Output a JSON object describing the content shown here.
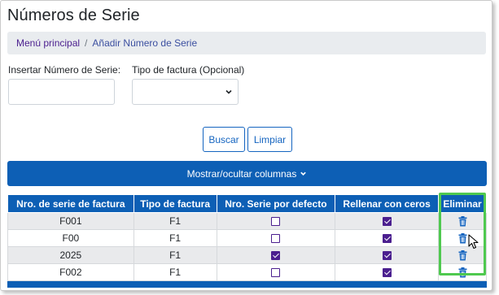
{
  "page": {
    "title": "Números de Serie"
  },
  "breadcrumb": {
    "home": "Menú principal",
    "separator": "/",
    "current": "Añadir Número de Serie"
  },
  "form": {
    "serie_label": "Insertar Número de Serie:",
    "serie_value": "",
    "tipo_label": "Tipo de factura (Opcional)",
    "tipo_selected": ""
  },
  "buttons": {
    "buscar": "Buscar",
    "limpiar": "Limpiar"
  },
  "toggle_columns": {
    "label": "Mostrar/ocultar columnas"
  },
  "table": {
    "headers": [
      "Nro. de serie de factura",
      "Tipo de factura",
      "Nro. Serie por defecto",
      "Rellenar con ceros",
      "Eliminar"
    ],
    "rows": [
      {
        "serie": "F001",
        "tipo": "F1",
        "por_defecto": false,
        "rellenar": true
      },
      {
        "serie": "F00",
        "tipo": "F1",
        "por_defecto": false,
        "rellenar": true
      },
      {
        "serie": "2025",
        "tipo": "F1",
        "por_defecto": true,
        "rellenar": true
      },
      {
        "serie": "F002",
        "tipo": "F1",
        "por_defecto": false,
        "rellenar": true
      }
    ]
  },
  "colors": {
    "primary": "#0d5fb5",
    "checkbox": "#4b1f8f",
    "highlight": "#4fc94f",
    "row_stripe": "#e9eaec"
  },
  "icons": {
    "delete": "trash-icon",
    "dropdown": "chevron-down-icon",
    "cursor": "mouse-pointer-icon"
  }
}
